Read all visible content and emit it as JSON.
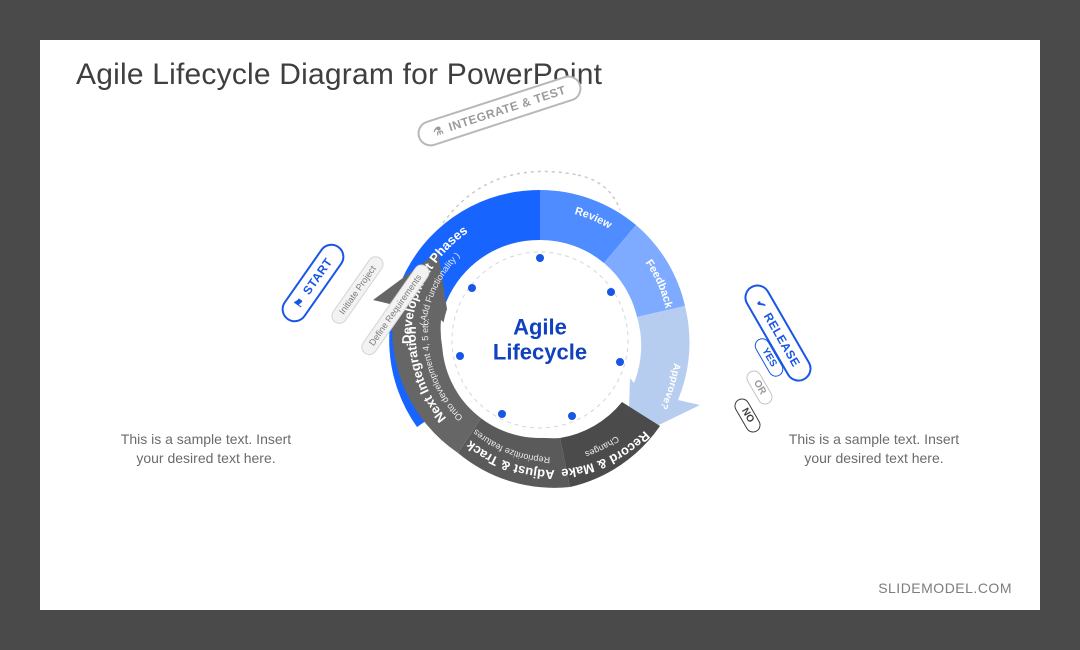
{
  "title": "Agile Lifecycle Diagram for PowerPoint",
  "footer": "SLIDEMODEL.COM",
  "center_line1": "Agile",
  "center_line2": "Lifecycle",
  "sample_left": "This is a sample text. Insert your desired text here.",
  "sample_right": "This is a sample text. Insert your desired text here.",
  "pills": {
    "start": "START",
    "integrate_test": "INTEGRATE & TEST",
    "release": "RELEASE",
    "yes": "YES",
    "or": "OR",
    "no": "NO",
    "initiate": "Initiate Project",
    "define": "Define Requirements"
  },
  "segments": {
    "dev_phases": {
      "title": "Development Phases",
      "sub": "( Add Functionality )"
    },
    "review": "Review",
    "feedback": "Feedback",
    "approve": "Approve?",
    "record": {
      "title": "Record & Make",
      "sub": "Changes"
    },
    "adjust": {
      "title": "Adjust & Track",
      "sub": "Reprioritize features"
    },
    "next": {
      "title": "Next Integration",
      "sub": "Onto development 4, 5 etc."
    }
  },
  "colors": {
    "blue_main": "#1864ff",
    "blue_mid": "#4f8cff",
    "blue_light": "#7eabff",
    "blue_pale": "#b7cdef",
    "grey_dark": "#4b4b4b",
    "grey_mid": "#5a5a5a",
    "grey_alt": "#666666"
  }
}
